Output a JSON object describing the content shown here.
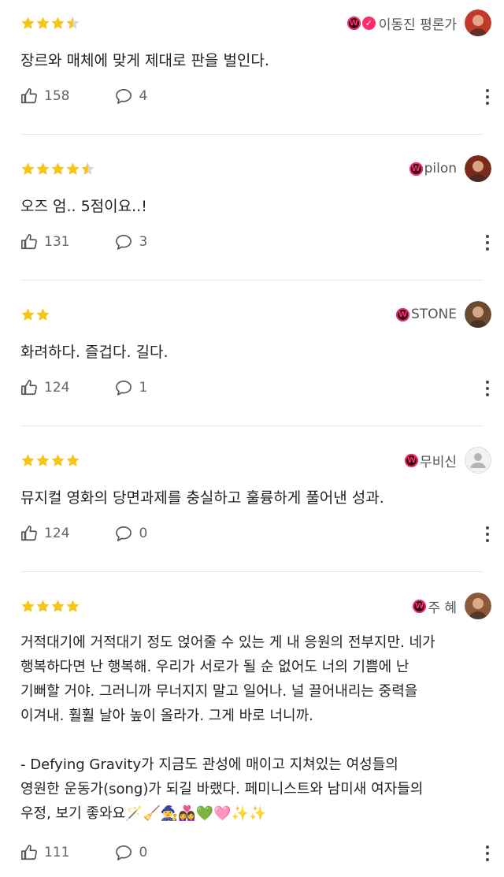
{
  "reviews": [
    {
      "rating": 3.5,
      "username": "이동진 평론가",
      "verified": true,
      "text": "장르와 매체에 맞게 제대로 판을 벌인다.",
      "likes": "158",
      "comments": "4",
      "avatar_color": "#c0392b"
    },
    {
      "rating": 4.5,
      "username": "pilon",
      "verified": false,
      "text": "오즈 엄.. 5점이요..!",
      "likes": "131",
      "comments": "3",
      "avatar_color": "#7a2a1a"
    },
    {
      "rating": 2,
      "username": "STONE",
      "verified": false,
      "text": "화려하다. 즐겁다. 길다.",
      "likes": "124",
      "comments": "1",
      "avatar_color": "#6b4a2e"
    },
    {
      "rating": 4,
      "username": "무비신",
      "verified": false,
      "text": "뮤지컬 영화의 당면과제를 충실하고 훌륭하게 풀어낸 성과.",
      "likes": "124",
      "comments": "0",
      "avatar_color": "#e0e0e0"
    },
    {
      "rating": 4,
      "username": "주 혜",
      "verified": false,
      "text": "거적대기에 거적대기 정도 얹어줄 수 있는 게 내 응원의 전부지만. 네가\n행복하다면 난 행복해. 우리가 서로가 될 순 없어도 너의 기쁨에 난\n기뻐할 거야. 그러니까 무너지지 말고 일어나. 널 끌어내리는 중력을\n이겨내. 훨훨 날아 높이 올라가. 그게 바로 너니까.\n\n- Defying Gravity가 지금도 관성에 매이고 지쳐있는 여성들의\n영원한 운동가(song)가 되길 바랬다. 페미니스트와 남미새 여자들의\n우정, 보기 좋와요🪄🧹🧙‍♀️👩‍❤️‍👩💚🩷✨✨",
      "likes": "111",
      "comments": "0",
      "avatar_color": "#8a5a3a"
    }
  ],
  "icons": {
    "like": "thumbs-up-icon",
    "comment": "speech-bubble-icon",
    "more": "more-vertical-icon",
    "badge": "watcha-badge-icon",
    "verified": "verified-check-icon"
  },
  "colors": {
    "star": "#f5c518",
    "star_empty": "#d9d9d9",
    "badge": "#ff2c6d"
  }
}
